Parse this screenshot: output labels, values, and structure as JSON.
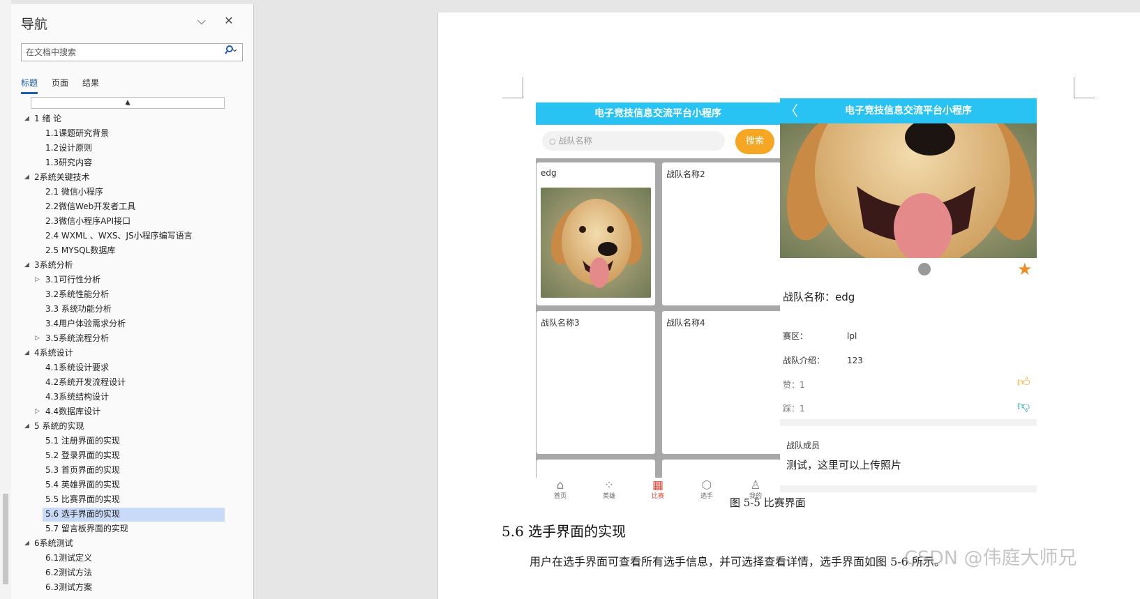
{
  "nav": {
    "title": "导航",
    "search_placeholder": "在文档中搜索",
    "tabs": [
      {
        "label": "标题",
        "active": true
      },
      {
        "label": "页面",
        "active": false
      },
      {
        "label": "结果",
        "active": false
      }
    ],
    "tree": [
      {
        "level": 1,
        "toggle": "◢",
        "label": "1 绪 论"
      },
      {
        "level": 2,
        "toggle": "",
        "label": "1.1课题研究背景"
      },
      {
        "level": 2,
        "toggle": "",
        "label": "1.2设计原则"
      },
      {
        "level": 2,
        "toggle": "",
        "label": "1.3研究内容"
      },
      {
        "level": 1,
        "toggle": "◢",
        "label": "2系统关键技术"
      },
      {
        "level": 2,
        "toggle": "",
        "label": "2.1 微信小程序"
      },
      {
        "level": 2,
        "toggle": "",
        "label": "2.2微信Web开发者工具"
      },
      {
        "level": 2,
        "toggle": "",
        "label": "2.3微信小程序API接口"
      },
      {
        "level": 2,
        "toggle": "",
        "label": "2.4 WXML 、WXS、JS小程序编写语言"
      },
      {
        "level": 2,
        "toggle": "",
        "label": "2.5 MYSQL数据库"
      },
      {
        "level": 1,
        "toggle": "◢",
        "label": "3系统分析"
      },
      {
        "level": 2,
        "toggle": "▷",
        "label": "3.1可行性分析"
      },
      {
        "level": 2,
        "toggle": "",
        "label": "3.2系统性能分析"
      },
      {
        "level": 2,
        "toggle": "",
        "label": "3.3  系统功能分析"
      },
      {
        "level": 2,
        "toggle": "",
        "label": "3.4用户体验需求分析"
      },
      {
        "level": 2,
        "toggle": "▷",
        "label": "3.5系统流程分析"
      },
      {
        "level": 1,
        "toggle": "◢",
        "label": "4系统设计"
      },
      {
        "level": 2,
        "toggle": "",
        "label": "4.1系统设计要求"
      },
      {
        "level": 2,
        "toggle": "",
        "label": "4.2系统开发流程设计"
      },
      {
        "level": 2,
        "toggle": "",
        "label": "4.3系统结构设计"
      },
      {
        "level": 2,
        "toggle": "▷",
        "label": "4.4数据库设计"
      },
      {
        "level": 1,
        "toggle": "◢",
        "label": "5 系统的实现"
      },
      {
        "level": 2,
        "toggle": "",
        "label": "5.1 注册界面的实现"
      },
      {
        "level": 2,
        "toggle": "",
        "label": "5.2 登录界面的实现"
      },
      {
        "level": 2,
        "toggle": "",
        "label": "5.3 首页界面的实现"
      },
      {
        "level": 2,
        "toggle": "",
        "label": "5.4 英雄界面的实现"
      },
      {
        "level": 2,
        "toggle": "",
        "label": "5.5 比赛界面的实现"
      },
      {
        "level": 2,
        "toggle": "",
        "label": "5.6 选手界面的实现",
        "selected": true
      },
      {
        "level": 2,
        "toggle": "",
        "label": "5.7 留言板界面的实现"
      },
      {
        "level": 1,
        "toggle": "◢",
        "label": "6系统测试"
      },
      {
        "level": 2,
        "toggle": "",
        "label": "6.1测试定义"
      },
      {
        "level": 2,
        "toggle": "",
        "label": "6.2测试方法"
      },
      {
        "level": 2,
        "toggle": "",
        "label": "6.3测试方案"
      }
    ]
  },
  "figure": {
    "phone1": {
      "title": "电子竞技信息交流平台小程序",
      "search_placeholder": "战队名称",
      "search_button": "搜索",
      "cards": [
        "edg",
        "战队名称2",
        "战队名称3",
        "战队名称4"
      ],
      "tabbar": [
        {
          "label": "首页",
          "icon": "home-icon"
        },
        {
          "label": "英雄",
          "icon": "grid-icon"
        },
        {
          "label": "比赛",
          "icon": "calendar-icon",
          "active": true
        },
        {
          "label": "选手",
          "icon": "cube-icon"
        },
        {
          "label": "我的",
          "icon": "user-icon"
        }
      ]
    },
    "phone2": {
      "title": "电子竞技信息交流平台小程序",
      "back": "〈",
      "team_name": "战队名称：edg",
      "region_label": "赛区：",
      "region_value": "lpl",
      "intro_label": "战队介绍：",
      "intro_value": "123",
      "likes": "赞：1",
      "dislikes": "踩：1",
      "members_title": "战队成员",
      "members_text": "测试，这里可以上传照片"
    },
    "caption": "图 5-5   比赛界面"
  },
  "doc": {
    "heading": "5.6  选手界面的实现",
    "paragraph": "用户在选手界面可查看所有选手信息，并可选择查看详情，选手界面如图 5-6 所示。"
  },
  "watermark": "CSDN @伟庭大师兄",
  "colors": {
    "accent_blue": "#1f5fae",
    "header_blue": "#29c3f3",
    "search_orange": "#f5a623",
    "selection": "#c9daf8"
  }
}
